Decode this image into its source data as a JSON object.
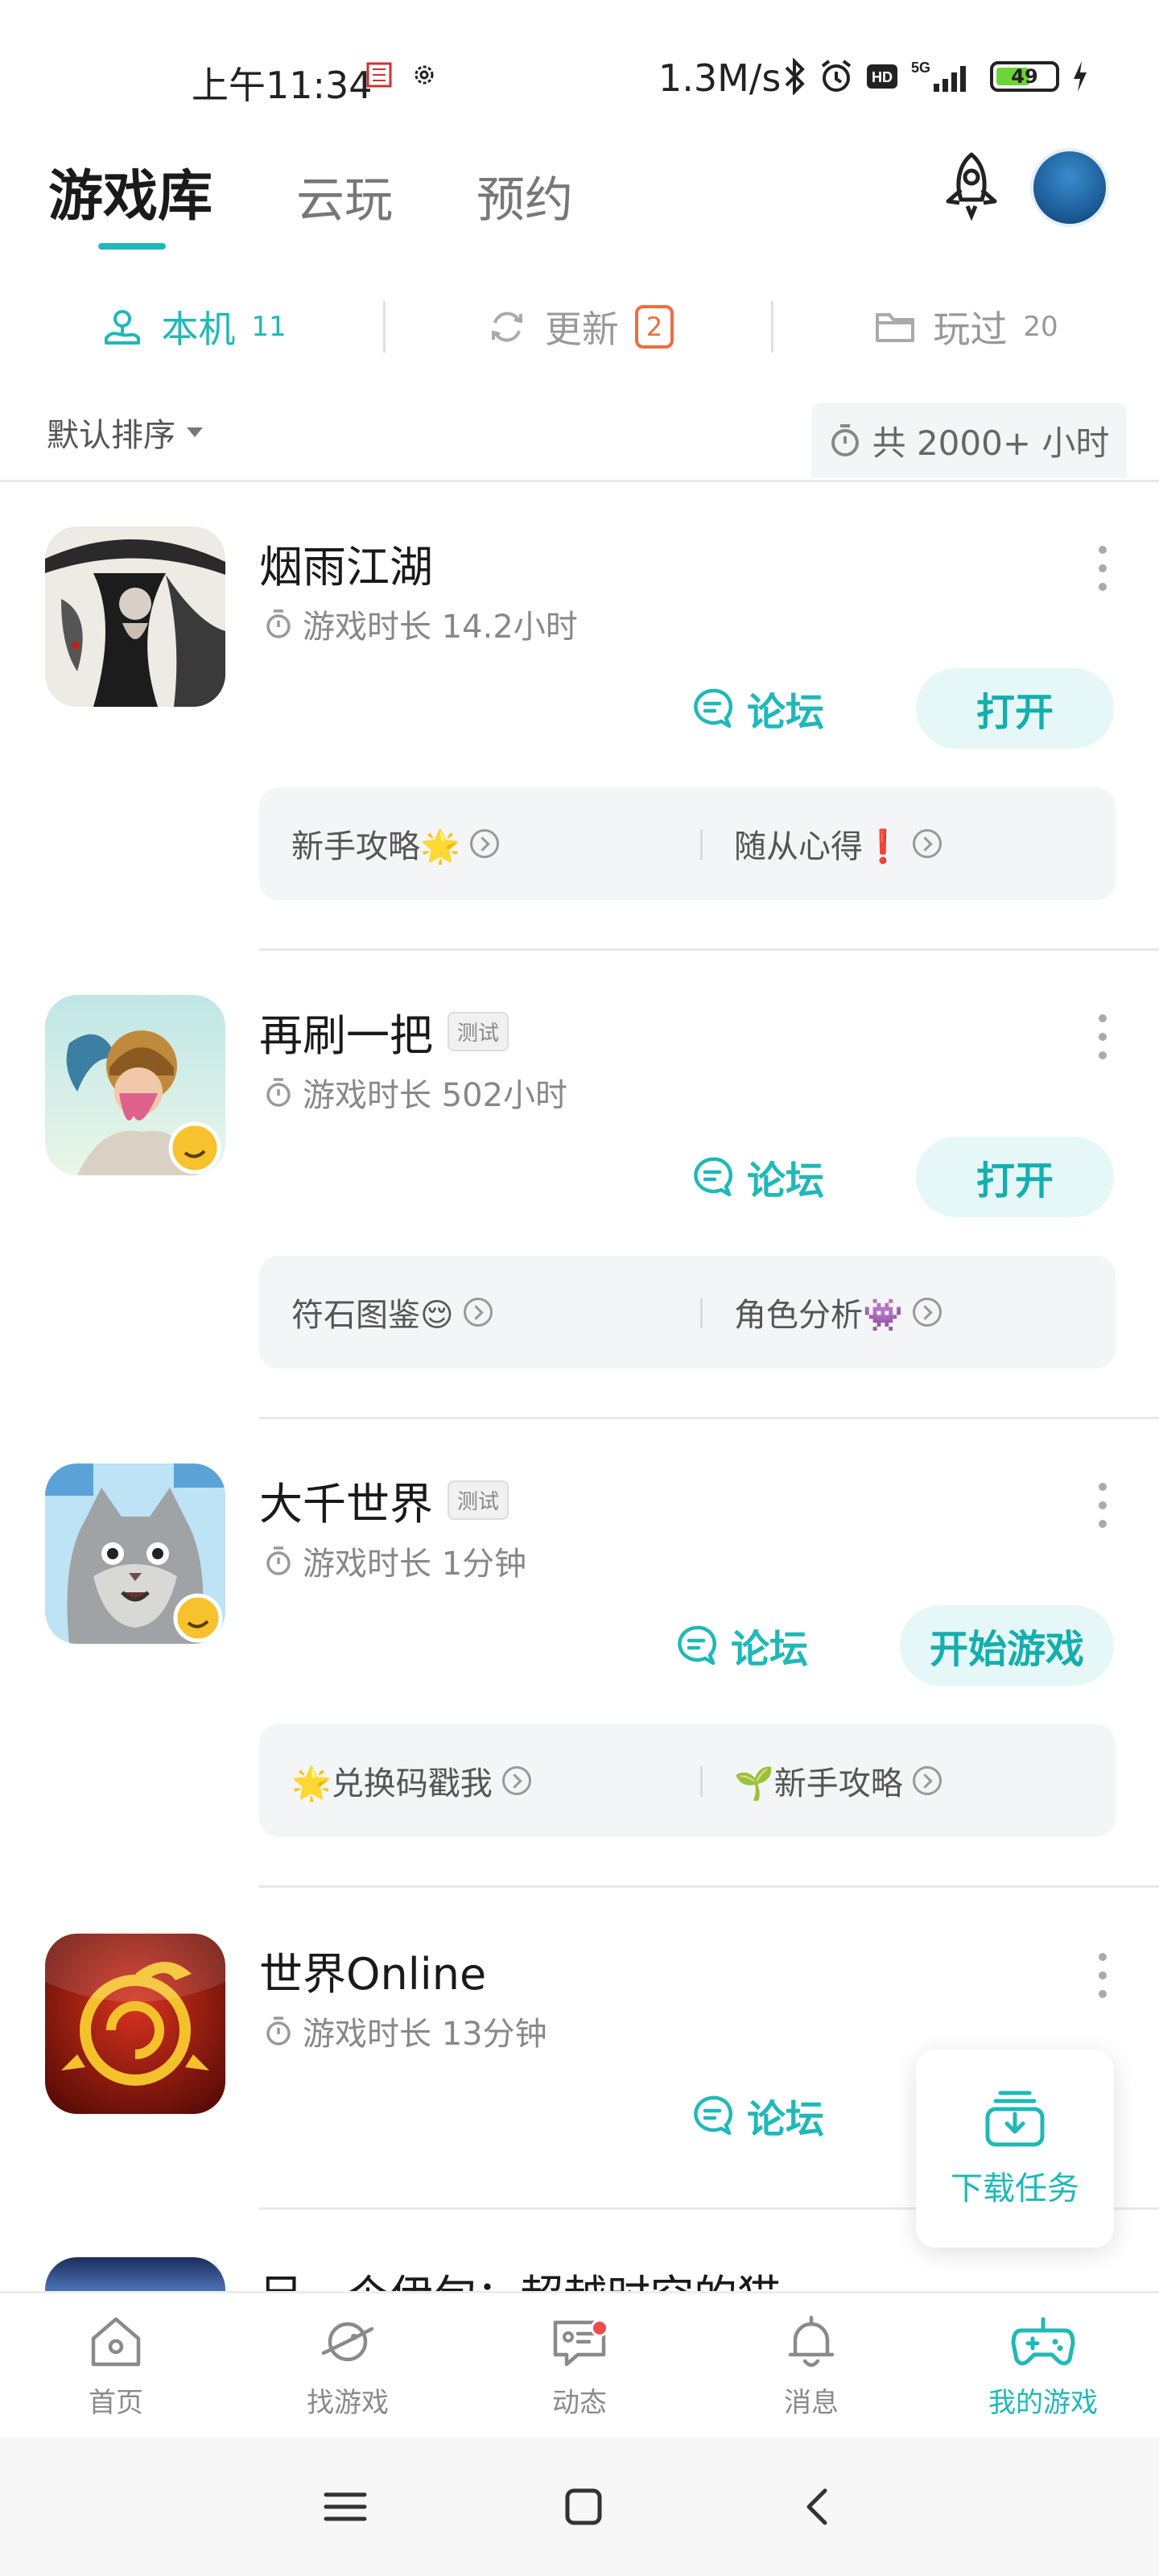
{
  "status_bar": {
    "time": "上午11:34",
    "speed": "1.3M/s",
    "battery": "49"
  },
  "header": {
    "tabs": [
      {
        "label": "游戏库",
        "active": true
      },
      {
        "label": "云玩",
        "active": false
      },
      {
        "label": "预约",
        "active": false
      }
    ]
  },
  "sub_tabs": [
    {
      "label": "本机",
      "count": "11",
      "icon": "device-icon",
      "active": true
    },
    {
      "label": "更新",
      "badge": "2",
      "icon": "refresh-icon",
      "active": false
    },
    {
      "label": "玩过",
      "count": "20",
      "icon": "folder-icon",
      "active": false
    }
  ],
  "sort": {
    "label": "默认排序",
    "total_time": "共 2000+ 小时"
  },
  "games": [
    {
      "title": "烟雨江湖",
      "tag": "",
      "play_time": "游戏时长 14.2小时",
      "forum_label": "论坛",
      "action_label": "打开",
      "guides": [
        {
          "text": "新手攻略🌟"
        },
        {
          "text": "随从心得❗"
        }
      ]
    },
    {
      "title": "再刷一把",
      "tag": "测试",
      "play_time": "游戏时长 502小时",
      "forum_label": "论坛",
      "action_label": "打开",
      "guides": [
        {
          "text": "符石图鉴😌"
        },
        {
          "text": "角色分析👾"
        }
      ]
    },
    {
      "title": "大千世界",
      "tag": "测试",
      "play_time": "游戏时长 1分钟",
      "forum_label": "论坛",
      "action_label": "开始游戏",
      "guides": [
        {
          "text": "🌟兑换码戳我"
        },
        {
          "text": "🌱新手攻略"
        }
      ]
    },
    {
      "title": "世界Online",
      "tag": "",
      "play_time": "游戏时长 13分钟",
      "forum_label": "论坛",
      "action_label": ""
    }
  ],
  "peek_game_title": "另一个伊甸：超越时空的猫",
  "download_float": {
    "label": "下载任务"
  },
  "bottom_nav": [
    {
      "label": "首页",
      "icon": "home-icon",
      "active": false
    },
    {
      "label": "找游戏",
      "icon": "planet-icon",
      "active": false
    },
    {
      "label": "动态",
      "icon": "chat-icon",
      "active": false
    },
    {
      "label": "消息",
      "icon": "bell-icon",
      "active": false
    },
    {
      "label": "我的游戏",
      "icon": "gamepad-icon",
      "active": true
    }
  ],
  "colors": {
    "accent": "#20b8b8",
    "badge": "#f06b3e"
  }
}
